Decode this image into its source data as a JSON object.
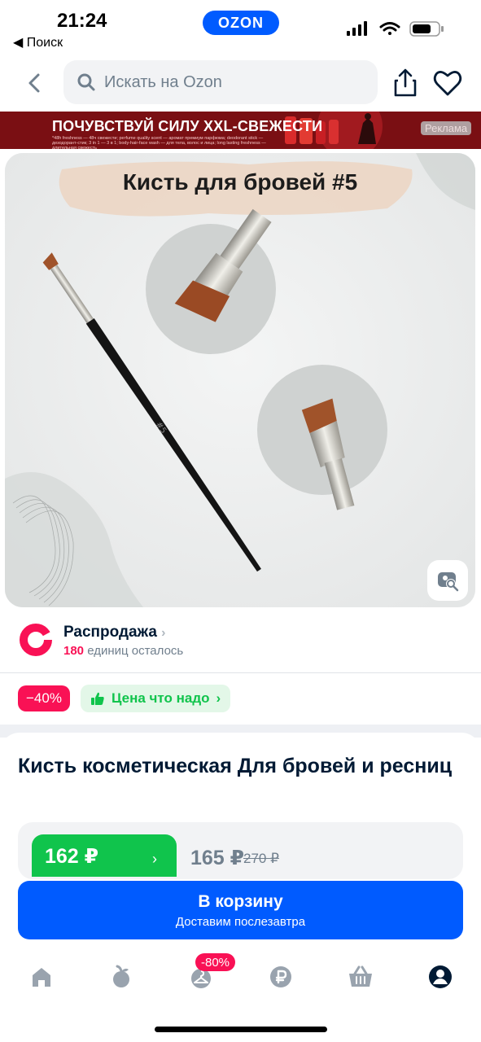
{
  "status_bar": {
    "time": "21:24",
    "app_badge": "OZON",
    "back_to_app": "◀ Поиск"
  },
  "top_bar": {
    "search_placeholder": "Искать на Ozon"
  },
  "banner": {
    "headline": "ПОЧУВСТВУЙ СИЛУ XXL-СВЕЖЕСТИ",
    "fine_print": "*48h freshness — 48ч свежести; perfume quality scent — аромат премиум парфюма; deodorant stick — дезодорант-стик; 3 in 1 — 3 в 1; body-hair-face wash — для тела, волос и лица; long lasting freshness — длительная свежесть",
    "ad_label": "Реклама"
  },
  "product_image": {
    "title": "Кисть для бровей #5",
    "handle_mark": "#5"
  },
  "sale": {
    "title": "Распродажа",
    "count": "180",
    "count_suffix": " единиц осталось"
  },
  "badges": {
    "discount": "−40%",
    "good_price": "Цена что надо"
  },
  "product": {
    "title": "Кисть косметическая Для бровей и ресниц",
    "price_card": "162 ₽",
    "price": "165 ₽",
    "price_old": "270 ₽"
  },
  "cart_button": {
    "label": "В корзину",
    "sub": "Доставим послезавтра"
  },
  "tab_bar": {
    "promo_badge": "-80%",
    "items": [
      "home-icon",
      "fresh-icon",
      "hanger-icon",
      "ruble-icon",
      "basket-icon",
      "profile-icon"
    ]
  },
  "colors": {
    "brand": "#005bff",
    "accent": "#f91155",
    "green": "#10c44c",
    "text": "#001a34",
    "muted": "#707f8d"
  }
}
